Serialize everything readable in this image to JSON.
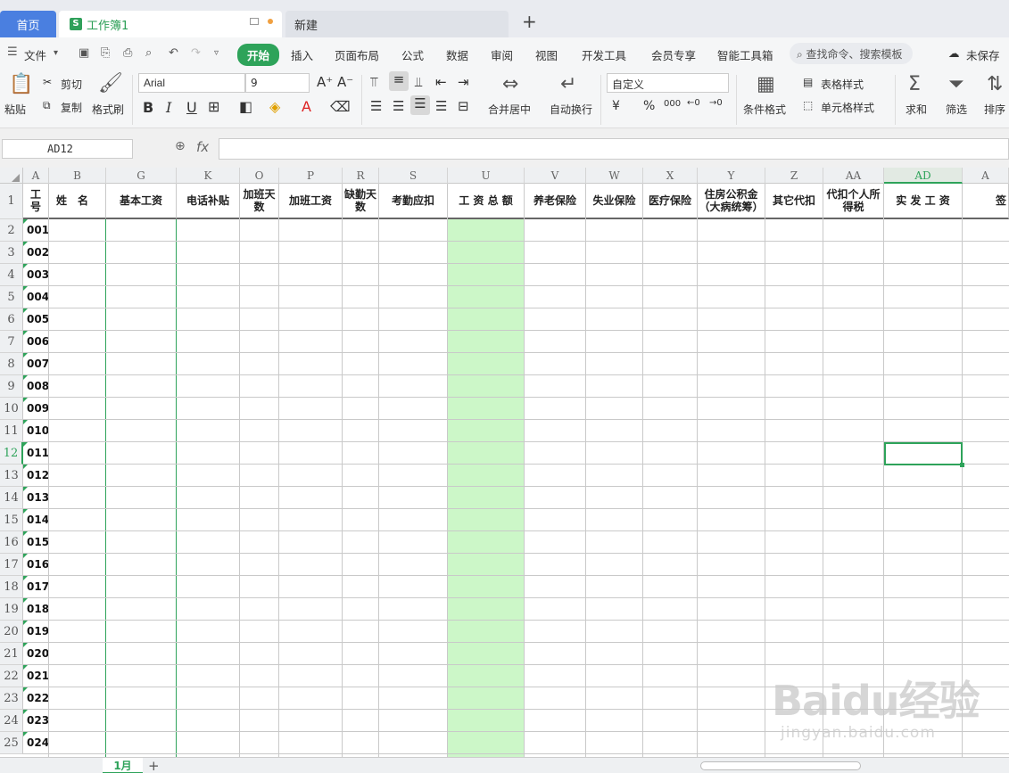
{
  "tabs": {
    "home": "首页",
    "workbook": "工作簿1",
    "new": "新建",
    "plus": "+"
  },
  "menu": {
    "file": "文件",
    "start": "开始",
    "items": [
      "插入",
      "页面布局",
      "公式",
      "数据",
      "审阅",
      "视图",
      "开发工具",
      "会员专享",
      "智能工具箱"
    ],
    "search_placeholder": "查找命令、搜索模板",
    "unsaved": "未保存"
  },
  "ribbon": {
    "paste": "粘贴",
    "cut": "剪切",
    "copy": "复制",
    "format_painter": "格式刷",
    "font_name": "Arial",
    "font_size": "9",
    "merge_center": "合并居中",
    "auto_wrap": "自动换行",
    "number_format": "自定义",
    "currency": "¥",
    "percent": "%",
    "thousands": "000",
    "conditional_format": "条件格式",
    "table_style": "表格样式",
    "cell_style": "单元格样式",
    "sum": "求和",
    "filter": "筛选",
    "sort": "排序"
  },
  "formula_bar": {
    "name_box": "AD12",
    "fx": "fx",
    "value": ""
  },
  "columns": [
    "A",
    "B",
    "G",
    "K",
    "O",
    "P",
    "R",
    "S",
    "U",
    "V",
    "W",
    "X",
    "Y",
    "Z",
    "AA",
    "AD",
    "A"
  ],
  "headers": [
    "工号",
    "姓　名",
    "基本工资",
    "电话补贴",
    "加班天数",
    "加班工资",
    "缺勤天数",
    "考勤应扣",
    "工 资 总 额",
    "养老保险",
    "失业保险",
    "医疗保险",
    "住房公积金（大病统筹）",
    "其它代扣",
    "代扣个人所得税",
    "实 发 工 资",
    "签"
  ],
  "row_numbers": [
    "1",
    "2",
    "3",
    "4",
    "5",
    "6",
    "7",
    "8",
    "9",
    "10",
    "11",
    "12",
    "13",
    "14",
    "15",
    "16",
    "17",
    "18",
    "19",
    "20",
    "21",
    "22",
    "23",
    "24",
    "25"
  ],
  "ids": [
    "001",
    "002",
    "003",
    "004",
    "005",
    "006",
    "007",
    "008",
    "009",
    "010",
    "011",
    "012",
    "013",
    "014",
    "015",
    "016",
    "017",
    "018",
    "019",
    "020",
    "021",
    "022",
    "023",
    "024"
  ],
  "sheet": {
    "name": "1月",
    "add": "+"
  },
  "watermark": {
    "line1": "Baidu经验",
    "line2": "jingyan.baidu.com"
  },
  "colors": {
    "accent": "#2ea35a",
    "highlight_column": "#ccf7c8",
    "home_tab": "#4a7fe0"
  }
}
